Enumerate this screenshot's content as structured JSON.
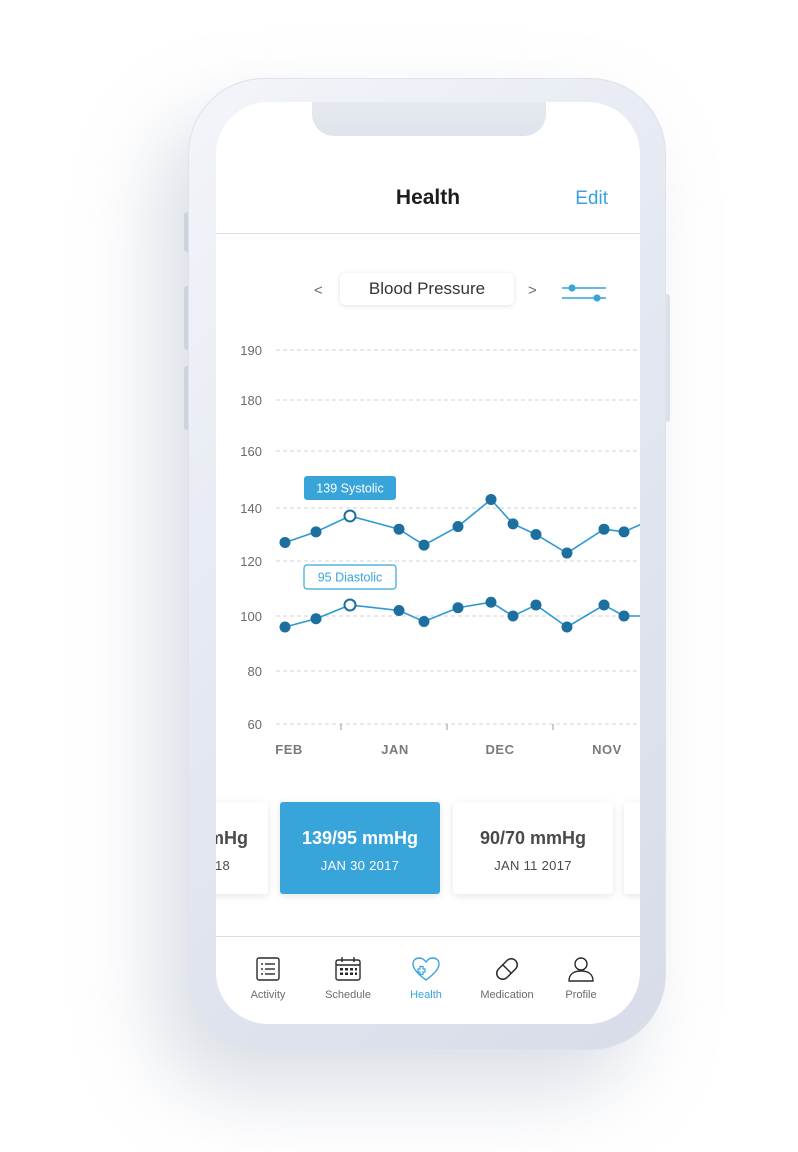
{
  "header": {
    "title": "Health",
    "edit_label": "Edit"
  },
  "metric": {
    "prev_label": "<",
    "next_label": ">",
    "name": "Blood Pressure",
    "filter_icon": "sliders-icon"
  },
  "colors": {
    "accent": "#37a4da",
    "line": "#2b9ad3",
    "marker": "#1d6fa0"
  },
  "chart_data": {
    "type": "line",
    "y_ticks": [
      60,
      80,
      100,
      120,
      140,
      160,
      180,
      190
    ],
    "x_labels": [
      "FEB",
      "JAN",
      "DEC",
      "NOV"
    ],
    "grid": true,
    "series": [
      {
        "name": "Systolic",
        "values": [
          127,
          131,
          137,
          132,
          126,
          133,
          143,
          134,
          130,
          123,
          132,
          131,
          135
        ],
        "highlight_index": 2,
        "tooltip": "139 Systolic"
      },
      {
        "name": "Diastolic",
        "values": [
          96,
          99,
          104,
          102,
          98,
          103,
          105,
          100,
          104,
          96,
          104,
          100,
          100
        ],
        "highlight_index": 2,
        "tooltip": "95 Diastolic"
      }
    ]
  },
  "readings": [
    {
      "value": "mHg",
      "date": "18"
    },
    {
      "value": "139/95 mmHg",
      "date": "JAN 30 2017"
    },
    {
      "value": "90/70 mmHg",
      "date": "JAN 11 2017"
    }
  ],
  "tabs": [
    {
      "label": "Activity",
      "icon": "list-icon"
    },
    {
      "label": "Schedule",
      "icon": "calendar-icon"
    },
    {
      "label": "Health",
      "icon": "heart-icon"
    },
    {
      "label": "Medication",
      "icon": "pill-icon"
    },
    {
      "label": "Profile",
      "icon": "person-icon"
    }
  ]
}
